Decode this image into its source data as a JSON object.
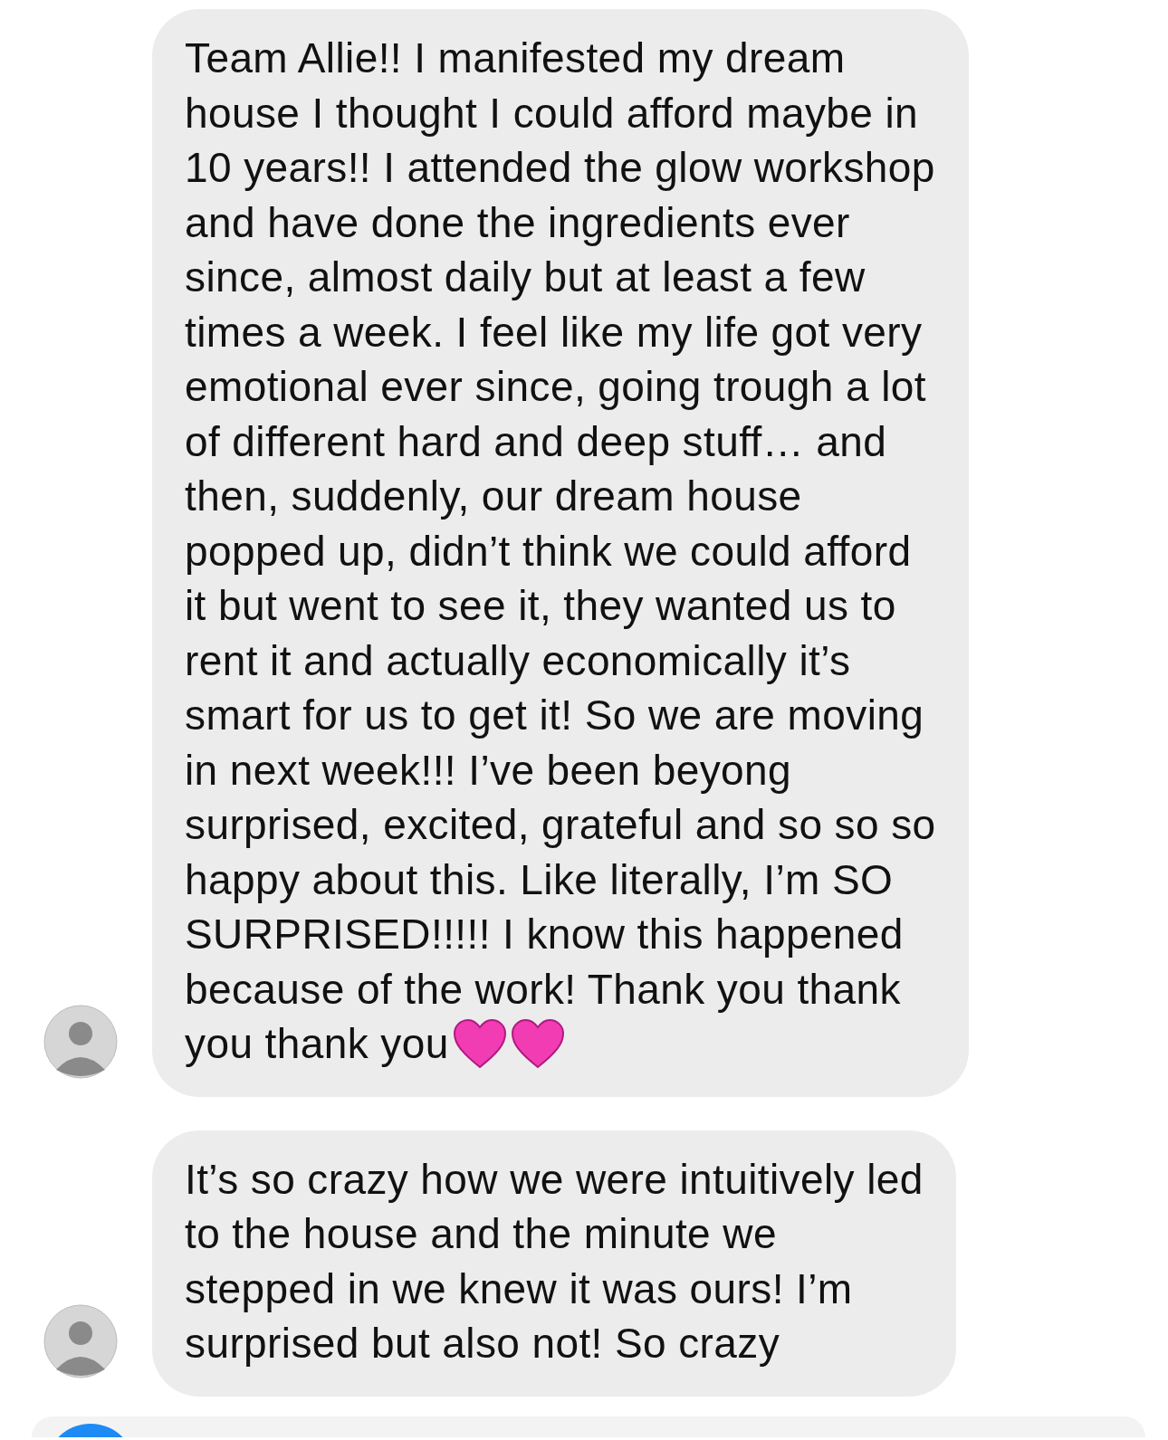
{
  "messages": [
    {
      "kind": "with-hearts",
      "text": "Team Allie!! I manifested my dream\nhouse I thought I could afford maybe in\n10 years!! I attended the glow workshop\nand have done the ingredients ever\nsince, almost daily but at least a few\ntimes a week. I feel like my life got very\nemotional ever since, going trough a lot\nof different hard and deep stuff… and\nthen, suddenly, our dream house\npopped up, didn’t think we could afford\nit but went to see it, they wanted us to\nrent it and actually economically it’s\nsmart for us to get it! So we are moving\nin next week!!! I’ve been beyong\nsurprised, excited, grateful and so so so\nhappy about this. Like literally, I’m SO\nSURPRISED!!!!! I know this happened\nbecause of the work! Thank you thank\nyou thank you"
    },
    {
      "kind": "plain",
      "text": "It’s so crazy how we were intuitively led\nto the house and the minute we\nstepped in we knew it was ours! I’m\nsurprised but also not! So crazy"
    }
  ]
}
